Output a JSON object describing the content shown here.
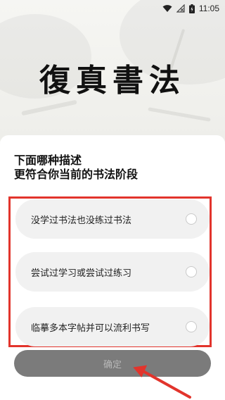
{
  "status_bar": {
    "time": "11:05",
    "icons": [
      "wifi-icon",
      "no-signal-icon",
      "battery-charging-icon"
    ]
  },
  "hero": {
    "title": "復真書法"
  },
  "question": {
    "line1": "下面哪种描述",
    "line2": "更符合你当前的书法阶段"
  },
  "options": [
    {
      "label": "没学过书法也没练过书法",
      "selected": false
    },
    {
      "label": "尝试过学习或尝试过练习",
      "selected": false
    },
    {
      "label": "临摹多本字帖并可以流利书写",
      "selected": false
    }
  ],
  "confirm_button": {
    "label": "确定",
    "enabled": false
  },
  "colors": {
    "annotation_red": "#e2342c",
    "button_disabled": "#7b7b7b",
    "option_bg": "#f1f1f1"
  }
}
